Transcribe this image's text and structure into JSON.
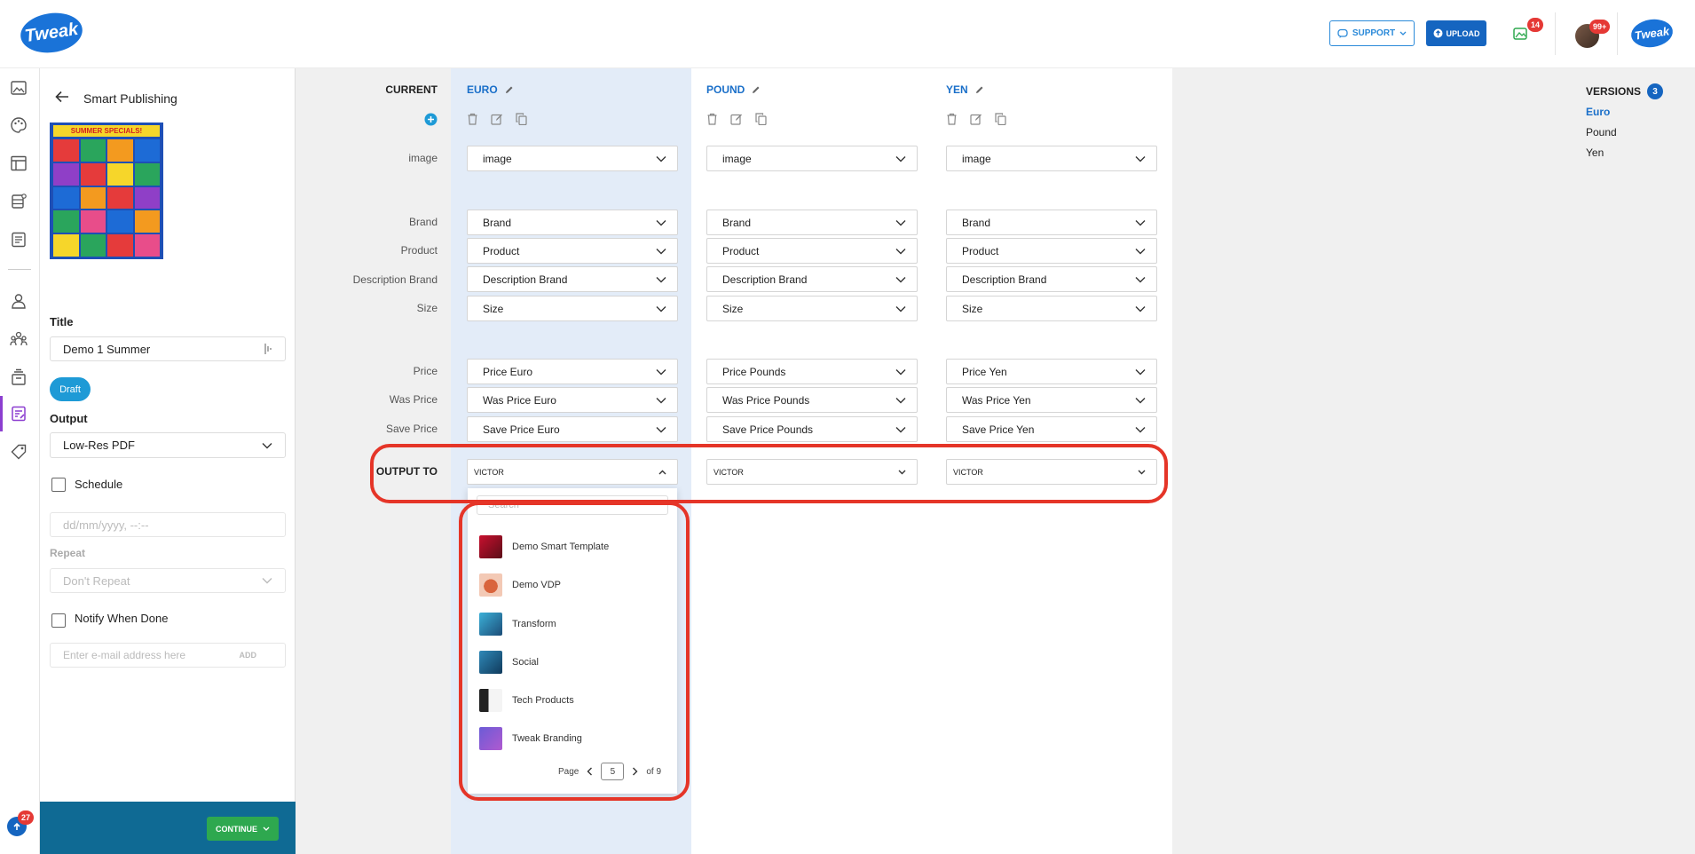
{
  "brand": {
    "logo_text": "Tweak",
    "accent": "#1a73d8"
  },
  "header": {
    "support_label": "SUPPORT",
    "upload_label": "UPLOAD",
    "notifications_count": "14",
    "avatar_count": "99+"
  },
  "sidebar_badge": "27",
  "left_panel": {
    "back_title": "Smart Publishing",
    "title_label": "Title",
    "title_value": "Demo 1 Summer",
    "status_label": "Draft",
    "output_label": "Output",
    "output_value": "Low-Res PDF",
    "schedule_label": "Schedule",
    "datetime_placeholder": "dd/mm/yyyy, --:--",
    "repeat_label": "Repeat",
    "repeat_value": "Don't Repeat",
    "notify_label": "Notify When Done",
    "email_placeholder": "Enter e-mail address here",
    "add_label": "ADD",
    "continue_label": "CONTINUE",
    "preview_caption": "SUMMER SPECIALS!"
  },
  "grid": {
    "current_label": "CURRENT",
    "columns": [
      {
        "name": "EURO",
        "image": "image",
        "brand": "Brand",
        "product": "Product",
        "description_brand": "Description Brand",
        "size": "Size",
        "price": "Price Euro",
        "was_price": "Was Price Euro",
        "save_price": "Save Price Euro",
        "output_to": "VICTOR"
      },
      {
        "name": "POUND",
        "image": "image",
        "brand": "Brand",
        "product": "Product",
        "description_brand": "Description Brand",
        "size": "Size",
        "price": "Price Pounds",
        "was_price": "Was Price Pounds",
        "save_price": "Save Price Pounds",
        "output_to": "VICTOR"
      },
      {
        "name": "YEN",
        "image": "image",
        "brand": "Brand",
        "product": "Product",
        "description_brand": "Description Brand",
        "size": "Size",
        "price": "Price Yen",
        "was_price": "Was Price Yen",
        "save_price": "Save Price Yen",
        "output_to": "VICTOR"
      }
    ],
    "row_labels": {
      "image": "image",
      "brand": "Brand",
      "product": "Product",
      "description_brand": "Description Brand",
      "size": "Size",
      "price": "Price",
      "was_price": "Was Price",
      "save_price": "Save Price",
      "output_to": "OUTPUT TO"
    }
  },
  "dropdown": {
    "search_placeholder": "Search",
    "items": [
      "Demo Smart Template",
      "Demo VDP",
      "Transform",
      "Social",
      "Tech Products",
      "Tweak Branding"
    ],
    "page_label": "Page",
    "page_current": "5",
    "page_total": "of 9"
  },
  "versions": {
    "title": "VERSIONS",
    "count": "3",
    "items": [
      "Euro",
      "Pound",
      "Yen"
    ]
  },
  "colors": {
    "highlight_col": "#e3ecf8",
    "red_outline": "#e53528",
    "draft": "#1e9ad6",
    "continue": "#2ea84f",
    "bottom_bar": "#0f6a94"
  }
}
